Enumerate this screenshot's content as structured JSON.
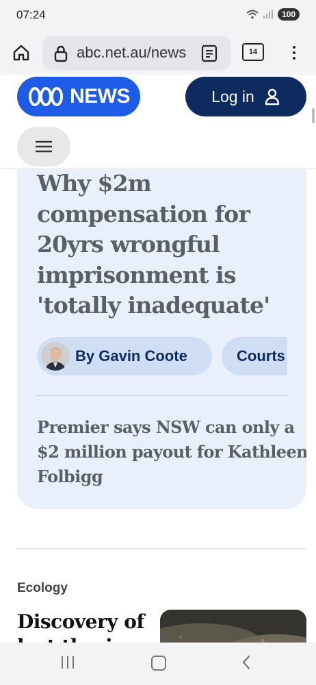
{
  "status": {
    "time": "07:24",
    "battery": "100"
  },
  "browser": {
    "url": "abc.net.au/news",
    "tab_count": "14"
  },
  "header": {
    "logo_text": "NEWS",
    "login_label": "Log in"
  },
  "article": {
    "headline": "Why $2m compensation for 20yrs wrongful imprisonment is 'totally inadequate'",
    "author": "By Gavin Coote",
    "topic": "Courts",
    "summary_line1": "Premier says NSW can only a",
    "summary_line2": "$2 million payout for Kathleen",
    "summary_line3": "Folbigg"
  },
  "next_story": {
    "category": "Ecology",
    "title": "Discovery of lost theri"
  },
  "colors": {
    "brand_blue": "#1e5be6",
    "navy": "#0d2b5e",
    "card_bg": "#eaf0fb"
  }
}
